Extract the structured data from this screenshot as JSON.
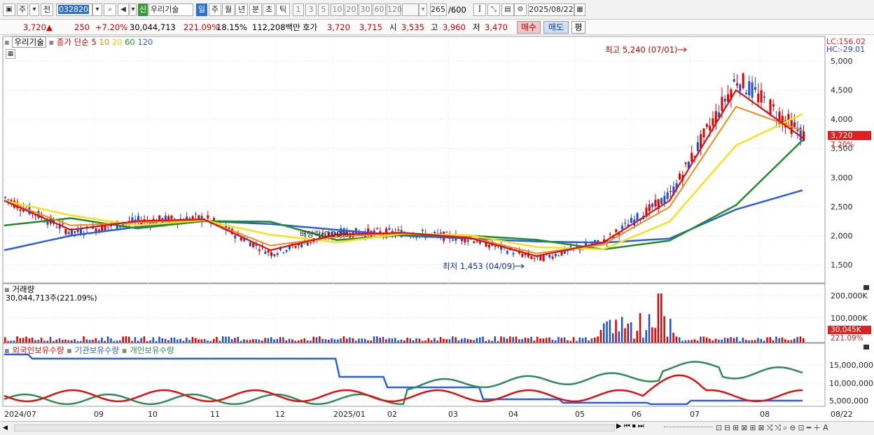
{
  "toolbar": {
    "ctype": "주",
    "prefix": "전",
    "code": "032820",
    "name": "우리기술",
    "new_badge": "신",
    "periods": [
      "일",
      "주",
      "월",
      "년",
      "분",
      "초",
      "틱"
    ],
    "mins": [
      "1",
      "3",
      "5",
      "10",
      "20",
      "30",
      "60",
      "120"
    ],
    "count": "265",
    "count_max": "/600",
    "date": "2025/08/22"
  },
  "quote": {
    "price": "3,720",
    "arrow": "▲",
    "change": "250",
    "pct": "+7.20%",
    "volume": "30,044,713",
    "vol_ratio": "221.09%",
    "turnover": "18.15%",
    "amount": "112,208백만",
    "hoga_label": "호가",
    "ask": "3,720",
    "bid": "3,715",
    "open_label": "시",
    "open": "3,535",
    "high_label": "고",
    "high": "3,960",
    "low_label": "저",
    "low": "3,470",
    "buy": "매수",
    "sell": "매도",
    "eval": "평"
  },
  "price_panel": {
    "title": "우리기술",
    "ma_label": "종가 단순",
    "ma": [
      "5",
      "10",
      "20",
      "60",
      "120"
    ],
    "lc": "LC:156.02",
    "hc": "HC:-29.01",
    "annot_high": "최고 5,240 (07/01)",
    "annot_low": "최저 1,453 (04/09)",
    "annot_div": "배당락(0.00%)",
    "cur_tag": "3,720",
    "cur_pct": "7.20%",
    "yticks": [
      "5,000",
      "4,500",
      "4,000",
      "3,500",
      "3,000",
      "2,500",
      "2,000",
      "1,500"
    ]
  },
  "volume_panel": {
    "title": "거래량",
    "sub": "30,044,713주(221.09%)",
    "yticks": [
      "200,000K",
      "100,000K"
    ],
    "tag": "30,045K",
    "tag2": "221.09%"
  },
  "holding_panel": {
    "legend": [
      "외국인보유수량",
      "기관보유수량",
      "개인보유수량"
    ],
    "yticks": [
      "15,000,000",
      "10,000,000",
      "5,000,000"
    ]
  },
  "xaxis": [
    "2024/07",
    "09",
    "10",
    "11",
    "12",
    "2025/01",
    "02",
    "03",
    "04",
    "05",
    "06",
    "07",
    "08",
    "08/22"
  ],
  "colors": {
    "up": "#e00000",
    "down": "#1d4fd8",
    "ma5": "#dd1111",
    "ma10": "#f08a1c",
    "ma20": "#f2e31a",
    "ma60": "#1f8f2a",
    "ma120": "#2f5fd6",
    "foreign": "#e01010",
    "inst": "#2b5fdc",
    "indiv": "#2e8b57"
  },
  "chart_data": {
    "type": "line",
    "title": "우리기술",
    "x": [
      "2024/07",
      "09",
      "10",
      "11",
      "12",
      "2025/01",
      "02",
      "03",
      "04",
      "05",
      "06",
      "07",
      "08"
    ],
    "series": [
      {
        "name": "종가",
        "values": [
          2650,
          2050,
          2250,
          2300,
          1700,
          2050,
          2050,
          1950,
          1600,
          1900,
          2700,
          4700,
          3720
        ]
      },
      {
        "name": "5",
        "values": [
          2600,
          2100,
          2250,
          2280,
          1750,
          2020,
          2050,
          1960,
          1650,
          1880,
          2600,
          4500,
          3680
        ]
      },
      {
        "name": "120",
        "values": [
          1750,
          2000,
          2150,
          2250,
          2200,
          2100,
          2000,
          1950,
          1900,
          1880,
          1950,
          2450,
          2780
        ]
      }
    ],
    "ylim": [
      1300,
      5300
    ],
    "annotations": [
      "최고 5,240 (07/01)",
      "최저 1,453 (04/09)"
    ]
  }
}
